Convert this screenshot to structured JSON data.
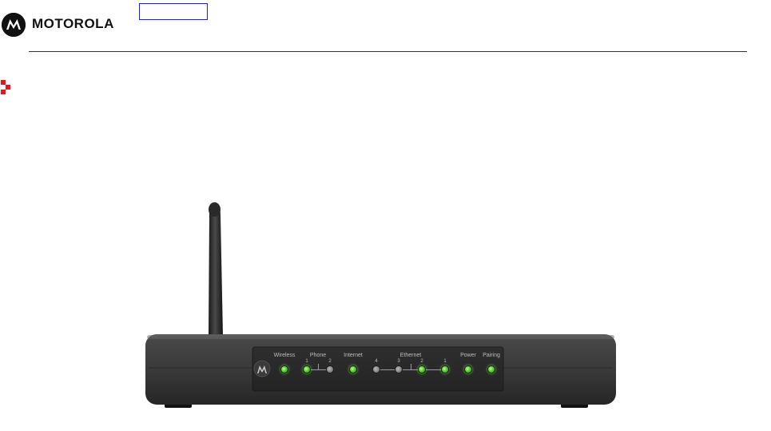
{
  "header": {
    "brand_name": "MOTOROLA",
    "logo_icon": "motorola-batwing-icon",
    "link_box_label": ""
  },
  "device": {
    "image_icon": "wireless-router-icon",
    "indicators": {
      "wireless": "Wireless",
      "phone": "Phone",
      "phone_ports": [
        "1",
        "2"
      ],
      "internet": "Internet",
      "ethernet": "Ethernet",
      "ethernet_ports": [
        "4",
        "3",
        "2",
        "1"
      ],
      "power": "Power",
      "pairing": "Pairing"
    },
    "led_states": {
      "wireless": "on",
      "phone_1": "on",
      "phone_2": "off",
      "internet": "on",
      "ethernet_4": "off",
      "ethernet_3": "off",
      "ethernet_2": "on",
      "ethernet_1": "on",
      "power": "on",
      "pairing": "on"
    }
  },
  "colors": {
    "brand_black": "#111111",
    "link_border": "#1a1aff",
    "bullet_red": "#e8141e",
    "led_green": "#55d12d",
    "led_off": "#8c8c8c",
    "device_body": "#3c3c3c"
  }
}
